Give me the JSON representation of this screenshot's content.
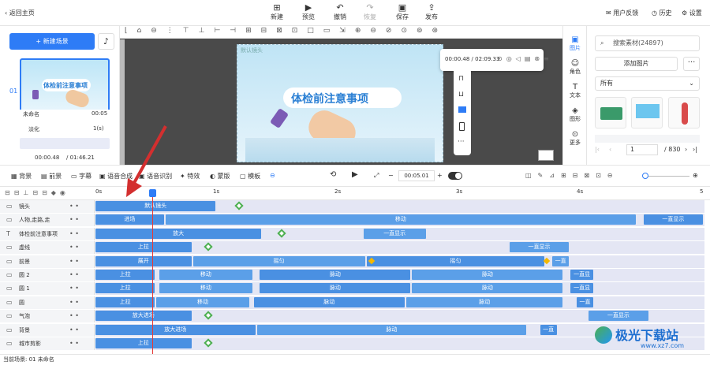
{
  "topbar": {
    "back": "返回主页",
    "new": "新建",
    "preview": "预览",
    "undo": "撤销",
    "redo": "恢复",
    "save": "保存",
    "publish": "发布",
    "feedback": "用户反馈",
    "history": "历史",
    "settings": "设置"
  },
  "left": {
    "new_scene": "新建场景",
    "scene_index": "01",
    "thumb_title": "体检前注意事项",
    "scene_name": "未命名",
    "scene_dur": "00:05",
    "transition": "淡化",
    "transition_dur": "1(s)",
    "time_cur": "00:00.48",
    "time_total": "/ 01:46.21"
  },
  "stage": {
    "title": "体检前注意事项",
    "watermark": "默认镜头"
  },
  "playpop": {
    "cur": "00:00.48",
    "total": "/ 02:09.33"
  },
  "sidetabs": [
    "图片",
    "角色",
    "文本",
    "图形",
    "更多"
  ],
  "right": {
    "search": "搜索素材(24897)",
    "add": "添加图片",
    "more": "···",
    "filter": "所有",
    "page": "1",
    "total": "/ 830"
  },
  "tlbar": {
    "bg": "背景",
    "fg": "前景",
    "caption": "字幕",
    "voice": "语音合成",
    "recog": "语音识别",
    "fx": "特效",
    "mask": "蒙版",
    "tpl": "模板",
    "dur": "00:05.01"
  },
  "ruler": [
    "0s",
    "1s",
    "2s",
    "3s",
    "4s",
    "5"
  ],
  "tracks": [
    {
      "name": "镜头",
      "clips": [
        {
          "t": "默认镜头",
          "a": 0,
          "b": 0.2
        }
      ]
    },
    {
      "name": "人物,走路,走",
      "clips": [
        {
          "t": "进场",
          "a": 0,
          "b": 0.115
        },
        {
          "t": "移动",
          "a": 0.115,
          "b": 0.89
        },
        {
          "t": "一直显示",
          "a": 0.9,
          "b": 1
        }
      ]
    },
    {
      "name": "体检前注意事项",
      "clips": [
        {
          "t": "放大",
          "a": 0,
          "b": 0.275
        },
        {
          "t": "一直显示",
          "a": 0.44,
          "b": 0.545
        }
      ]
    },
    {
      "name": "虚线",
      "clips": [
        {
          "t": "上拉",
          "a": 0,
          "b": 0.16
        },
        {
          "t": "一直显示",
          "a": 0.68,
          "b": 0.78
        }
      ]
    },
    {
      "name": "前景",
      "clips": [
        {
          "t": "展开",
          "a": 0,
          "b": 0.16
        },
        {
          "t": "摇匀",
          "a": 0.16,
          "b": 0.445
        },
        {
          "t": "摇匀",
          "a": 0.445,
          "b": 0.74
        },
        {
          "t": "一直",
          "a": 0.75,
          "b": 0.78
        }
      ]
    },
    {
      "name": "圆 2",
      "clips": [
        {
          "t": "上拉",
          "a": 0,
          "b": 0.1
        },
        {
          "t": "移动",
          "a": 0.105,
          "b": 0.26
        },
        {
          "t": "脉动",
          "a": 0.27,
          "b": 0.52
        },
        {
          "t": "脉动",
          "a": 0.52,
          "b": 0.77
        },
        {
          "t": "一直显",
          "a": 0.78,
          "b": 0.82
        }
      ]
    },
    {
      "name": "圆 1",
      "clips": [
        {
          "t": "上拉",
          "a": 0,
          "b": 0.1
        },
        {
          "t": "移动",
          "a": 0.105,
          "b": 0.26
        },
        {
          "t": "脉动",
          "a": 0.27,
          "b": 0.52
        },
        {
          "t": "脉动",
          "a": 0.52,
          "b": 0.77
        },
        {
          "t": "一直显",
          "a": 0.78,
          "b": 0.82
        }
      ]
    },
    {
      "name": "圆",
      "clips": [
        {
          "t": "上拉",
          "a": 0,
          "b": 0.1
        },
        {
          "t": "移动",
          "a": 0.1,
          "b": 0.255
        },
        {
          "t": "脉动",
          "a": 0.26,
          "b": 0.51
        },
        {
          "t": "脉动",
          "a": 0.51,
          "b": 0.77
        },
        {
          "t": "一直",
          "a": 0.79,
          "b": 0.82
        }
      ]
    },
    {
      "name": "气泡",
      "clips": [
        {
          "t": "放大进场",
          "a": 0,
          "b": 0.16
        },
        {
          "t": "一直显示",
          "a": 0.81,
          "b": 0.91
        }
      ]
    },
    {
      "name": "背景",
      "clips": [
        {
          "t": "放大进场",
          "a": 0,
          "b": 0.265
        },
        {
          "t": "脉动",
          "a": 0.265,
          "b": 0.71
        },
        {
          "t": "一直",
          "a": 0.73,
          "b": 0.76
        }
      ]
    },
    {
      "name": "城市剪影",
      "clips": [
        {
          "t": "上拉",
          "a": 0,
          "b": 0.16
        }
      ]
    }
  ],
  "status": "当前场景: 01  未命名",
  "watermark_text": "极光下载站",
  "watermark_url": "www.xz7.com"
}
